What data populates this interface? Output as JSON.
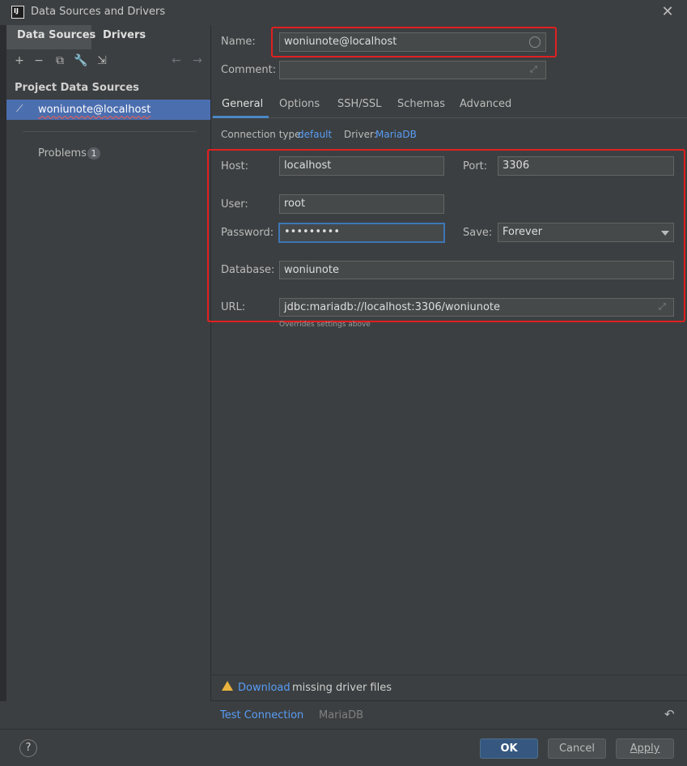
{
  "window": {
    "title": "Data Sources and Drivers"
  },
  "left": {
    "tabs": [
      "Data Sources",
      "Drivers"
    ],
    "toolbar": {
      "add": "+",
      "remove": "−",
      "copy": "⧉",
      "settings": "🔧",
      "import": "⇲",
      "back": "←",
      "forward": "→"
    },
    "section_title": "Project Data Sources",
    "selected_item": "woniunote@localhost",
    "problems_label": "Problems",
    "problems_count": "1"
  },
  "right": {
    "name_label": "Name:",
    "name_value": "woniunote@localhost",
    "comment_label": "Comment:",
    "comment_value": "",
    "tabs": [
      "General",
      "Options",
      "SSH/SSL",
      "Schemas",
      "Advanced"
    ],
    "connection_type_label": "Connection type:",
    "connection_type_value": "default",
    "driver_label": "Driver:",
    "driver_value": "MariaDB",
    "host_label": "Host:",
    "host_value": "localhost",
    "port_label": "Port:",
    "port_value": "3306",
    "user_label": "User:",
    "user_value": "root",
    "password_label": "Password:",
    "password_value": "•••••••••",
    "save_label": "Save:",
    "save_value": "Forever",
    "database_label": "Database:",
    "database_value": "woniunote",
    "url_label": "URL:",
    "url_value": "jdbc:mariadb://localhost:3306/woniunote",
    "url_hint": "Overrides settings above"
  },
  "warning": {
    "link": "Download",
    "text": "missing driver files"
  },
  "strip": {
    "test_connection": "Test Connection",
    "driver": "MariaDB",
    "revert": "↶"
  },
  "footer": {
    "help": "?",
    "ok": "OK",
    "cancel": "Cancel",
    "apply": "Apply"
  },
  "colors": {
    "accent": "#4a88c7",
    "selection": "#4b6eaf",
    "highlight_box": "#e02020",
    "link": "#589df6",
    "warning": "#e8b23c"
  }
}
